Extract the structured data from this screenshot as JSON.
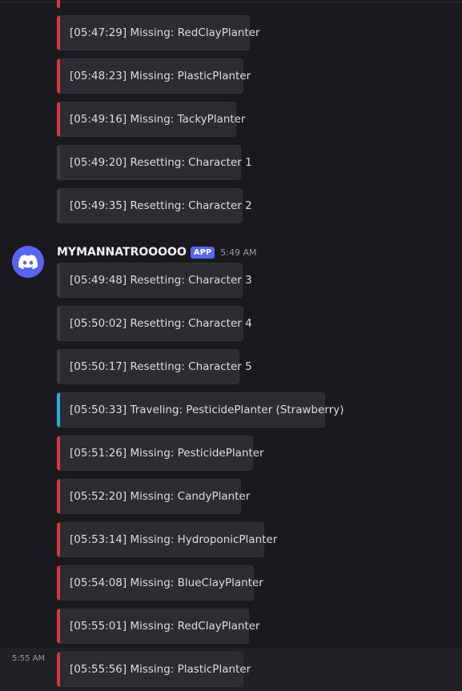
{
  "colors": {
    "background": "#1a1a1e",
    "embed_background": "#2b2d31",
    "missing_accent": "#da373c",
    "traveling_accent": "#21b3e0",
    "resetting_accent": "#3b3d43",
    "brand": "#5865f2"
  },
  "message_group": {
    "username": "MYMANNATROOOOO",
    "badge": "APP",
    "timestamp": "5:49 AM",
    "avatar_icon": "discord-logo-icon"
  },
  "hover_timestamp": "5:55 AM",
  "embeds": [
    {
      "text": "[05:47:29] Missing: RedClayPlanter",
      "kind": "missing"
    },
    {
      "text": "[05:48:23] Missing: PlasticPlanter",
      "kind": "missing"
    },
    {
      "text": "[05:49:16] Missing: TackyPlanter",
      "kind": "missing"
    },
    {
      "text": "[05:49:20] Resetting: Character 1",
      "kind": "resetting"
    },
    {
      "text": "[05:49:35] Resetting: Character 2",
      "kind": "resetting"
    },
    {
      "text": "[05:49:48] Resetting: Character 3",
      "kind": "resetting"
    },
    {
      "text": "[05:50:02] Resetting: Character 4",
      "kind": "resetting"
    },
    {
      "text": "[05:50:17] Resetting: Character 5",
      "kind": "resetting"
    },
    {
      "text": "[05:50:33] Traveling: PesticidePlanter (Strawberry)",
      "kind": "traveling"
    },
    {
      "text": "[05:51:26] Missing: PesticidePlanter",
      "kind": "missing"
    },
    {
      "text": "[05:52:20] Missing: CandyPlanter",
      "kind": "missing"
    },
    {
      "text": "[05:53:14] Missing: HydroponicPlanter",
      "kind": "missing"
    },
    {
      "text": "[05:54:08] Missing: BlueClayPlanter",
      "kind": "missing"
    },
    {
      "text": "[05:55:01] Missing: RedClayPlanter",
      "kind": "missing"
    },
    {
      "text": "[05:55:56] Missing: PlasticPlanter",
      "kind": "missing"
    }
  ]
}
